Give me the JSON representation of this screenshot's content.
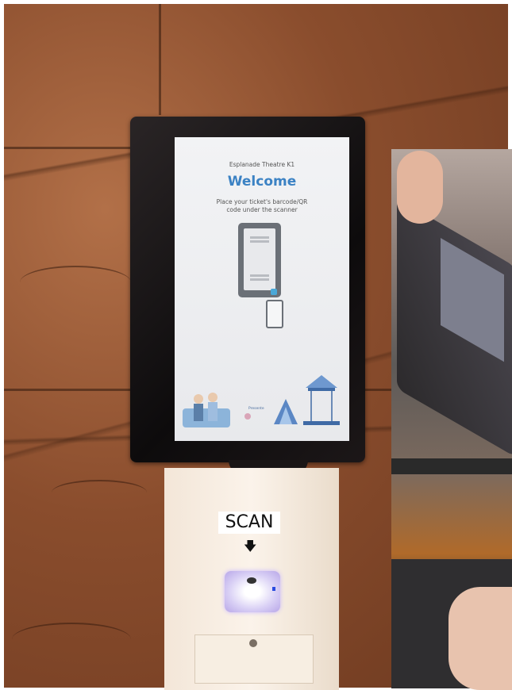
{
  "tablet_screen": {
    "status_text": "",
    "venue": "Esplanade Theatre K1",
    "title": "Welcome",
    "instruction": "Place your ticket's barcode/QR code under the scanner",
    "illustration_caption": "Presente",
    "colors": {
      "title": "#3b82c4",
      "phone": "#6b7077",
      "scanner_accent": "#4aa8d8"
    }
  },
  "kiosk": {
    "scan_label": "SCAN",
    "arrow_icon": "arrow-down-icon",
    "scanner_led_color": "#2a4be0"
  }
}
